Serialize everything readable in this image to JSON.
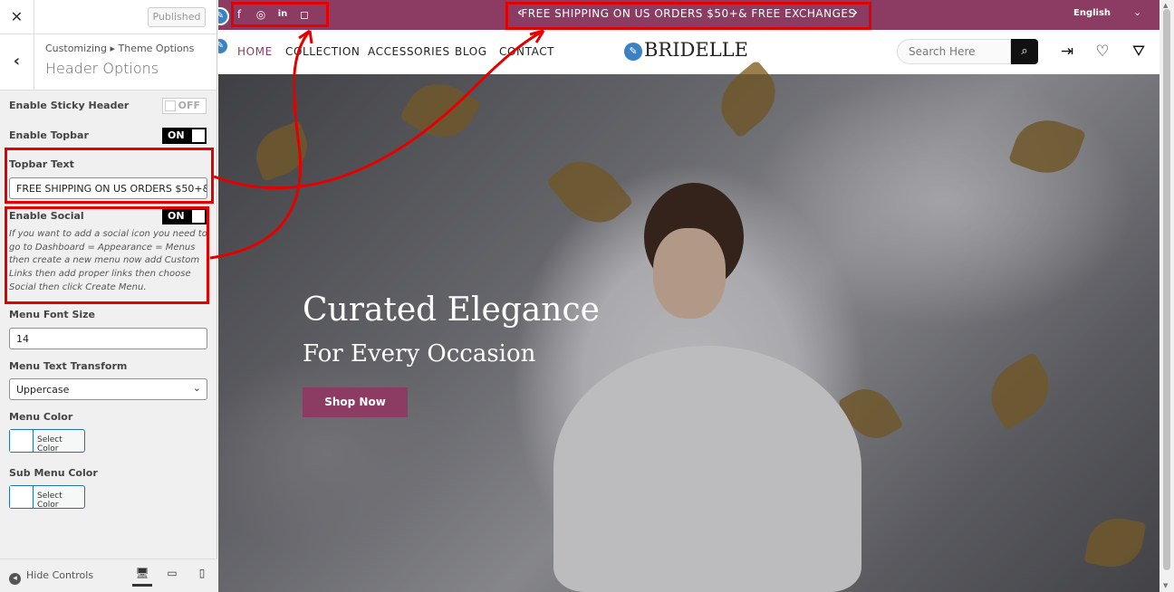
{
  "customizer": {
    "published_label": "Published",
    "breadcrumb": "Customizing ▸ Theme Options",
    "section_title": "Header Options",
    "fields": {
      "sticky_header": {
        "label": "Enable Sticky Header",
        "state": "OFF"
      },
      "topbar": {
        "label": "Enable Topbar",
        "state": "ON"
      },
      "topbar_text": {
        "label": "Topbar Text",
        "value": "FREE SHIPPING ON US ORDERS $50+& FREE EXCHANGES"
      },
      "social": {
        "label": "Enable Social",
        "state": "ON",
        "help": "If you want to add a social icon you need to go to Dashboard = Appearance = Menus then create a new menu now add Custom Links then add proper links then choose Social then click Create Menu."
      },
      "menu_font_size": {
        "label": "Menu Font Size",
        "value": "14"
      },
      "menu_text_transform": {
        "label": "Menu Text Transform",
        "value": "Uppercase"
      },
      "menu_color": {
        "label": "Menu Color",
        "button": "Select Color"
      },
      "sub_menu_color": {
        "label": "Sub Menu Color",
        "button": "Select Color"
      }
    },
    "footer": {
      "hide_controls": "Hide Controls"
    }
  },
  "site": {
    "topbar": {
      "social_icons": [
        "facebook-icon",
        "whatsapp-icon",
        "linkedin-icon",
        "instagram-icon"
      ],
      "promo_text": "FREE SHIPPING ON US ORDERS $50+& FREE EXCHANGES",
      "language": "English"
    },
    "nav": {
      "items": [
        "HOME",
        "COLLECTION",
        "ACCESSORIES",
        "BLOG",
        "CONTACT"
      ],
      "active": "HOME",
      "logo": "BRIDELLE",
      "search_placeholder": "Search Here"
    },
    "hero": {
      "title": "Curated Elegance",
      "subtitle": "For Every Occasion",
      "cta": "Shop Now"
    }
  },
  "colors": {
    "brand": "#8c3b63",
    "annotation": "#e50000",
    "toggle_on": "#000000"
  }
}
